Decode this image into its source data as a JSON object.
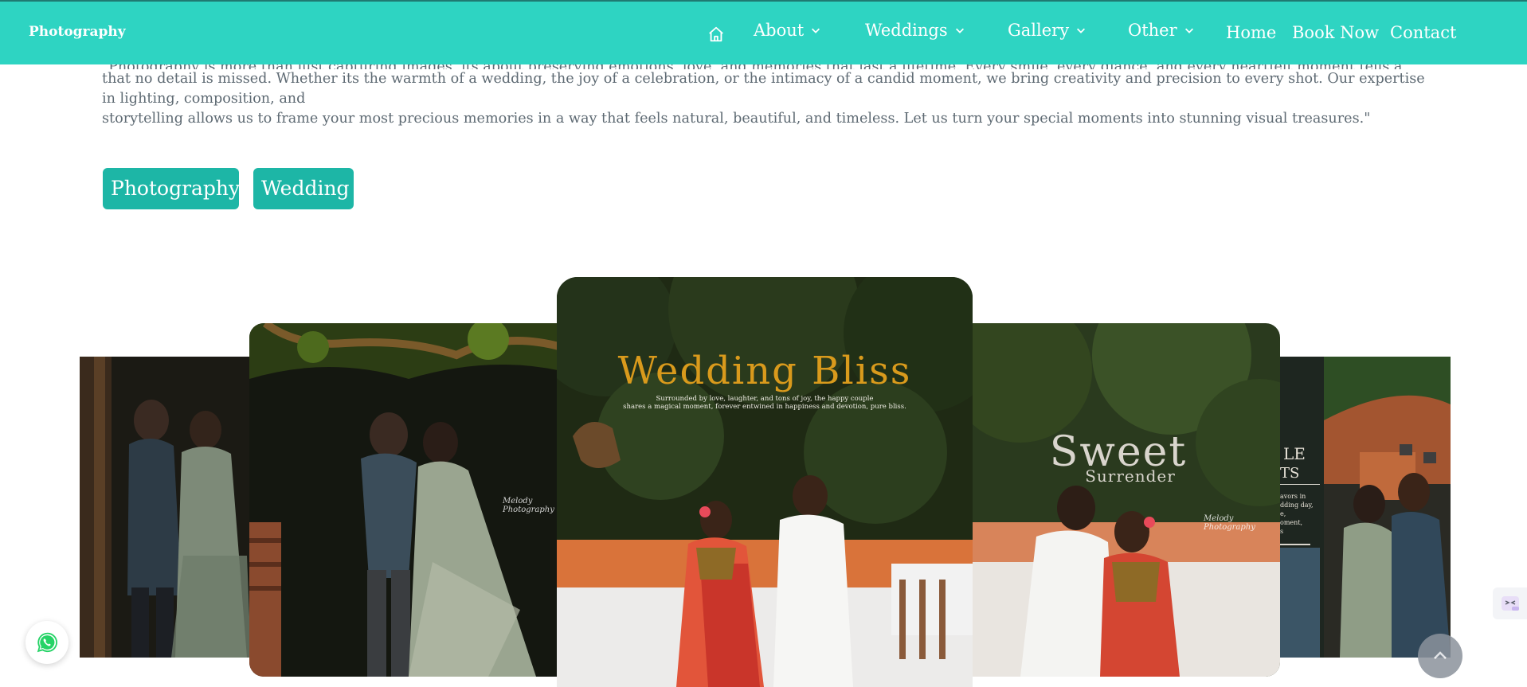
{
  "nav": {
    "brand": "Photography",
    "items": [
      {
        "label": "About",
        "has_dropdown": true
      },
      {
        "label": "Weddings",
        "has_dropdown": true
      },
      {
        "label": "Gallery",
        "has_dropdown": true
      },
      {
        "label": "Other",
        "has_dropdown": true
      }
    ],
    "links": [
      "Home",
      "Book Now",
      "Contact"
    ],
    "home_icon": "home-icon",
    "accent_color": "#2ed4c2"
  },
  "intro": {
    "line1": "\"Photography is more than just capturing images, its about preserving emotions, love, and memories that last a lifetime. Every smile, every glance, and every heartfelt moment tells a unique story, and we ensure",
    "line2": "that no detail is missed. Whether its the warmth of a wedding, the joy of a celebration, or the intimacy of a candid moment, we bring creativity and precision to every shot. Our expertise in lighting, composition, and",
    "line3": "storytelling allows us to frame your most precious memories in a way that feels natural, beautiful, and timeless. Let us turn your special moments into stunning visual treasures.\""
  },
  "tags": [
    "Photography",
    "Wedding"
  ],
  "carousel": {
    "center_title": "Wedding Bliss",
    "center_sub_1": "Surrounded by love, laughter, and tons of joy, the happy couple",
    "center_sub_2": "shares a magical moment, forever entwined in happiness and devotion, pure bliss.",
    "right_title": "Sweet",
    "right_subtitle": "Surrender",
    "signature": "Melody Photography",
    "far_right_title_1": "LE",
    "far_right_title_2": "TS",
    "far_right_text_1": "avors in",
    "far_right_text_2": "dding day,",
    "far_right_text_3": "e,",
    "far_right_text_4": "oment,",
    "far_right_text_5": "s"
  },
  "floating": {
    "whatsapp_icon": "whatsapp-icon",
    "scroll_top_icon": "chevron-up-icon",
    "widget_icon": "chat-widget-icon"
  }
}
